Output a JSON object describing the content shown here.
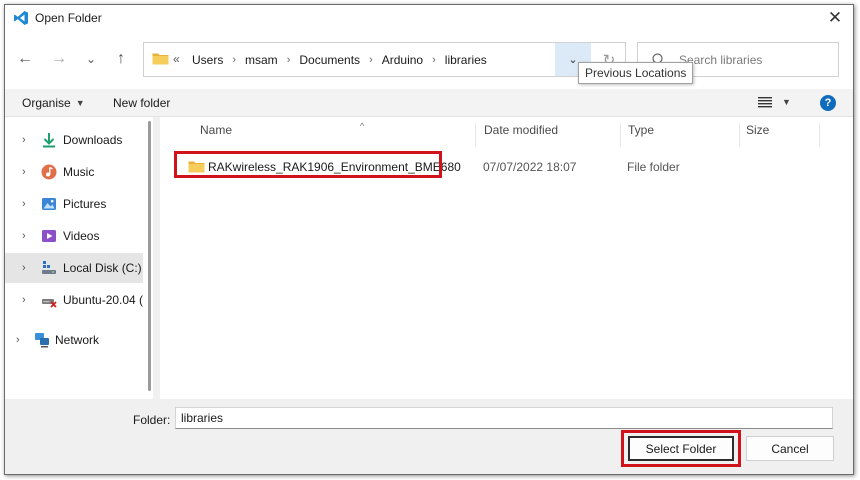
{
  "window": {
    "title": "Open Folder",
    "close_glyph": "✕"
  },
  "nav": {
    "back_glyph": "←",
    "forward_glyph": "→",
    "recent_glyph": "⌄",
    "up_glyph": "↑",
    "address_prefix": "«",
    "breadcrumbs": [
      "Users",
      "msam",
      "Documents",
      "Arduino",
      "libraries"
    ],
    "dropdown_glyph": "⌄",
    "refresh_glyph": "↻",
    "tooltip": "Previous Locations"
  },
  "search": {
    "placeholder": "Search libraries"
  },
  "commandbar": {
    "organise_label": "Organise",
    "new_folder_label": "New folder",
    "help_glyph": "?"
  },
  "sidebar": {
    "items": [
      {
        "label": "Downloads",
        "icon": "download-icon"
      },
      {
        "label": "Music",
        "icon": "music-icon"
      },
      {
        "label": "Pictures",
        "icon": "pictures-icon"
      },
      {
        "label": "Videos",
        "icon": "videos-icon"
      },
      {
        "label": "Local Disk (C:)",
        "icon": "drive-icon",
        "selected": true
      },
      {
        "label": "Ubuntu-20.04 (",
        "icon": "linux-drive-icon"
      },
      {
        "label": "Network",
        "icon": "network-icon"
      }
    ]
  },
  "columns": [
    "Name",
    "Date modified",
    "Type",
    "Size"
  ],
  "files": [
    {
      "name": "RAKwireless_RAK1906_Environment_BME680",
      "date_modified": "07/07/2022 18:07",
      "type": "File folder",
      "size": ""
    }
  ],
  "footer": {
    "folder_label": "Folder:",
    "folder_value": "libraries",
    "select_label": "Select Folder",
    "cancel_label": "Cancel"
  },
  "colors": {
    "accent": "#0f6cbd",
    "highlight_box": "#d0121b",
    "folder": "#f2c24a"
  }
}
